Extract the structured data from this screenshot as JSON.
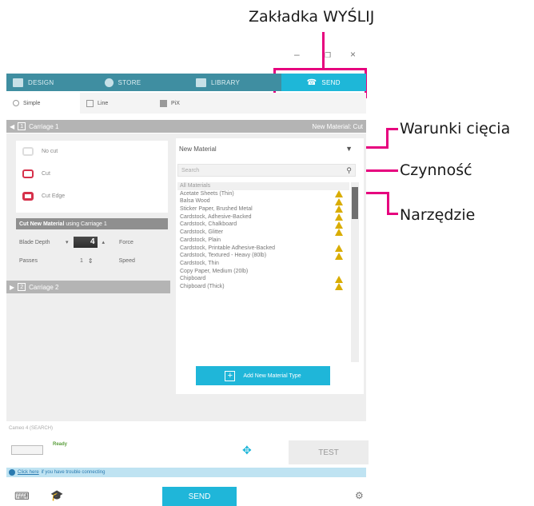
{
  "annotations": {
    "send_tab": "Zakładka WYŚLIJ",
    "cut_conditions": "Warunki cięcia",
    "action": "Czynność",
    "tool": "Narzędzie"
  },
  "window": {
    "minimize": "–",
    "restore": "❐",
    "close": "×"
  },
  "topnav": {
    "design": "DESIGN",
    "store": "STORE",
    "library": "LIBRARY",
    "send": "SEND"
  },
  "modes": {
    "simple": "Simple",
    "line": "Line",
    "pix": "PiX"
  },
  "carriage1": {
    "title": "Carriage 1",
    "material_label": "New Material: Cut"
  },
  "carriage2": {
    "title": "Carriage 2"
  },
  "actions": {
    "no_cut": "No cut",
    "cut": "Cut",
    "cut_edge": "Cut Edge"
  },
  "cut_settings": {
    "title": "Cut New Material",
    "subtitle": "using Carriage 1",
    "blade_depth_label": "Blade Depth",
    "blade_depth_value": "4",
    "force_label": "Force",
    "passes_label": "Passes",
    "passes_value": "1",
    "speed_label": "Speed"
  },
  "materials": {
    "selected": "New Material",
    "search_placeholder": "Search",
    "header": "All Materials",
    "items": [
      {
        "name": "Acetate Sheets (Thin)",
        "warn": true
      },
      {
        "name": "Balsa Wood",
        "warn": true
      },
      {
        "name": "Sticker Paper, Brushed Metal",
        "warn": true
      },
      {
        "name": "Cardstock, Adhesive-Backed",
        "warn": true
      },
      {
        "name": "Cardstock, Chalkboard",
        "warn": true
      },
      {
        "name": "Cardstock, Glitter",
        "warn": true
      },
      {
        "name": "Cardstock, Plain",
        "warn": false
      },
      {
        "name": "Cardstock, Printable Adhesive-Backed",
        "warn": true
      },
      {
        "name": "Cardstock, Textured - Heavy (80lb)",
        "warn": true
      },
      {
        "name": "Cardstock, Thin",
        "warn": false
      },
      {
        "name": "Copy Paper, Medium (20lb)",
        "warn": false
      },
      {
        "name": "Chipboard",
        "warn": true
      },
      {
        "name": "Chipboard (Thick)",
        "warn": true
      }
    ],
    "add_button": "Add New Material Type"
  },
  "device": {
    "name": "Cameo 4 (SEARCH)",
    "status": "Ready",
    "test": "TEST"
  },
  "info": {
    "link": "Click here",
    "text": "if you have trouble connecting"
  },
  "bottom": {
    "send": "SEND"
  },
  "colors": {
    "accent": "#1fb6d9",
    "annotation": "#e6007e",
    "nav": "#3f8ea1",
    "warning": "#d9ac00",
    "cut_icon": "#d6314b"
  }
}
